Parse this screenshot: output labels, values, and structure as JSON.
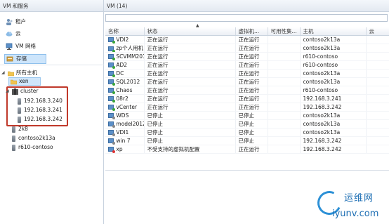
{
  "left_pane": {
    "title": "VM 和服务",
    "nav": [
      {
        "label": "租户",
        "icon": "tenant-icon"
      },
      {
        "label": "云",
        "icon": "cloud-icon"
      },
      {
        "label": "VM 网络",
        "icon": "vm-network-icon"
      },
      {
        "label": "存储",
        "icon": "storage-icon"
      }
    ],
    "all_hosts": "所有主机",
    "xen_group": "xen",
    "cluster_label": "cluster",
    "cluster_nodes": [
      "192.168.3.240",
      "192.168.3.241",
      "192.168.3.242"
    ],
    "hosts": [
      "2k8",
      "contoso2k13a",
      "r610-contoso"
    ]
  },
  "right_pane": {
    "title": "VM (14)",
    "columns": [
      "名称",
      "状态",
      "虚拟机...",
      "可用性集...",
      "主机",
      "云"
    ],
    "rows": [
      {
        "name": "VDI2",
        "status": "正在运行",
        "vm_status": "正在运行",
        "host": "contoso2k13a",
        "state": "run"
      },
      {
        "name": "zp个人用机",
        "status": "正在运行",
        "vm_status": "正在运行",
        "host": "contoso2k13a",
        "state": "run"
      },
      {
        "name": "SCVMM2012",
        "status": "正在运行",
        "vm_status": "正在运行",
        "host": "r610-contoso",
        "state": "run"
      },
      {
        "name": "AD2",
        "status": "正在运行",
        "vm_status": "正在运行",
        "host": "r610-contoso",
        "state": "run"
      },
      {
        "name": "DC",
        "status": "正在运行",
        "vm_status": "正在运行",
        "host": "contoso2k13a",
        "state": "run"
      },
      {
        "name": "SQL2012",
        "status": "正在运行",
        "vm_status": "正在运行",
        "host": "contoso2k13a",
        "state": "run"
      },
      {
        "name": "Chaos",
        "status": "正在运行",
        "vm_status": "正在运行",
        "host": "r610-contoso",
        "state": "run"
      },
      {
        "name": "08r2",
        "status": "正在运行",
        "vm_status": "正在运行",
        "host": "192.168.3.241",
        "state": "run"
      },
      {
        "name": "vCenter",
        "status": "正在运行",
        "vm_status": "正在运行",
        "host": "192.168.3.242",
        "state": "run"
      },
      {
        "name": "WDS",
        "status": "已停止",
        "vm_status": "已停止",
        "host": "contoso2k13a",
        "state": "stop"
      },
      {
        "name": "model2012",
        "status": "已停止",
        "vm_status": "已停止",
        "host": "contoso2k13a",
        "state": "stop"
      },
      {
        "name": "VDI1",
        "status": "已停止",
        "vm_status": "已停止",
        "host": "contoso2k13a",
        "state": "stop"
      },
      {
        "name": "win 7",
        "status": "已停止",
        "vm_status": "已停止",
        "host": "192.168.3.242",
        "state": "stop"
      },
      {
        "name": "xp",
        "status": "不受支持的虚拟机配置",
        "vm_status": "正在运行",
        "host": "192.168.3.242",
        "state": "unsup"
      }
    ]
  },
  "watermark": {
    "text_cn": "运维网",
    "url": "iyunv.com"
  }
}
